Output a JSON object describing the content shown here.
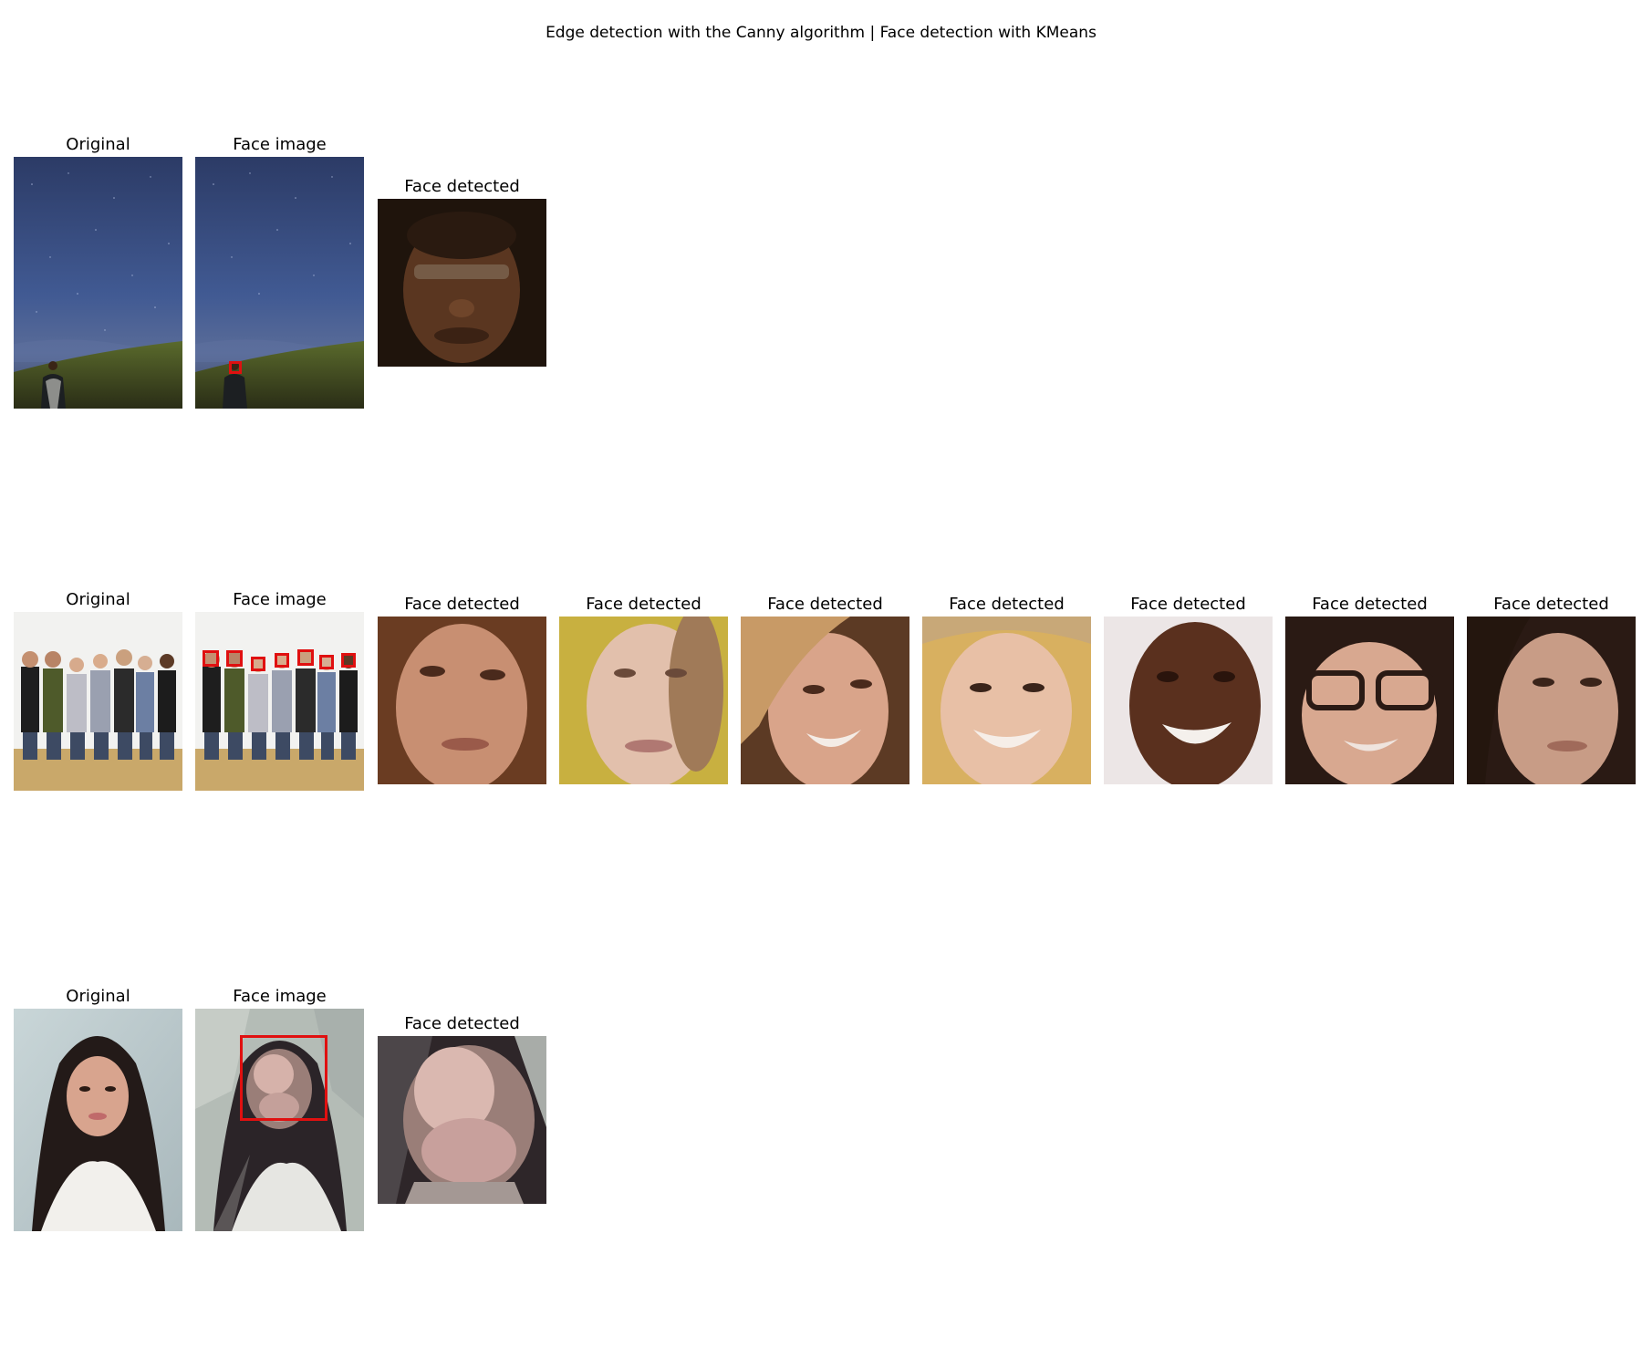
{
  "figure": {
    "title": "Edge detection with the Canny algorithm | Face detection with KMeans"
  },
  "panels": {
    "original": "Original",
    "face_image": "Face image",
    "face_detected": "Face detected"
  },
  "rows": [
    {
      "scene": "night-sky-single-person",
      "faces_detected": 1
    },
    {
      "scene": "group-of-seven-women",
      "faces_detected": 7
    },
    {
      "scene": "woman-portrait-kmeans-segmented",
      "faces_detected": 1
    }
  ],
  "colors": {
    "face_box": "#e01010",
    "background": "#ffffff"
  }
}
